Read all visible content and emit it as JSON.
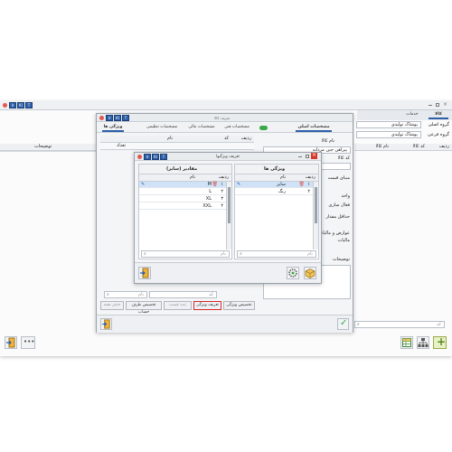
{
  "main": {
    "title_buttons": [
      "Ir",
      "Kl",
      "T"
    ],
    "header_right": "کالا",
    "header_left": "خدمات",
    "columns": [
      "ردیف",
      "کد کالا",
      "نام کالا",
      "توضیحات"
    ],
    "search_placeholder": "کد",
    "bottom_buttons": [
      "exit",
      "more",
      "add",
      "group",
      "excel"
    ]
  },
  "groups": {
    "col1_label": "گروه اصلی",
    "col1_value": "پوشاک تولیدی",
    "col2_label": "گروه فرعی",
    "col2_value": "پوشاک تولیدی"
  },
  "product": {
    "title": "تعریف کالا",
    "tabs": [
      "مشخصات اصلی",
      "مشخصات فنی",
      "مشخصات مالی",
      "مشخصات تنظیمی",
      "ویژگی ها"
    ],
    "fields": {
      "name_label": "نام کالا",
      "name_value": "پیراهن جین مردانه",
      "code_label": "کد کالا",
      "base_price_label": "مبنای قیمت",
      "unit_label": "واحد",
      "active_label": "فعال سازی",
      "min_label": "حداقل مقدار",
      "tax_label": "مالیات",
      "duty_label": "عوارض و مالیات",
      "desc_label": "توضیحات"
    },
    "grid_cols": [
      "ردیف",
      "کد",
      "نام",
      "تعداد"
    ],
    "search_placeholder": "کد",
    "name_placeholder": "نام",
    "buttons": [
      "تخصیص ویژگی",
      "تعریف ویژگی",
      "ثبت قیمت",
      "تخصیص طرف حساب",
      "حذف همه"
    ]
  },
  "features": {
    "title": "تعریف ویژگیها",
    "left_title": "مقادیر (سایز)",
    "right_title": "ویژگی ها",
    "left_cols": [
      "ردیف",
      "نام"
    ],
    "right_cols": [
      "ردیف",
      "نام"
    ],
    "values": [
      {
        "idx": "۱",
        "name": "M"
      },
      {
        "idx": "۲",
        "name": "L"
      },
      {
        "idx": "۳",
        "name": "XL"
      },
      {
        "idx": "۴",
        "name": "XXL"
      }
    ],
    "attrs": [
      {
        "idx": "۱",
        "name": "سایز"
      },
      {
        "idx": "۲",
        "name": "رنگ"
      }
    ],
    "search_placeholder": "نام"
  }
}
